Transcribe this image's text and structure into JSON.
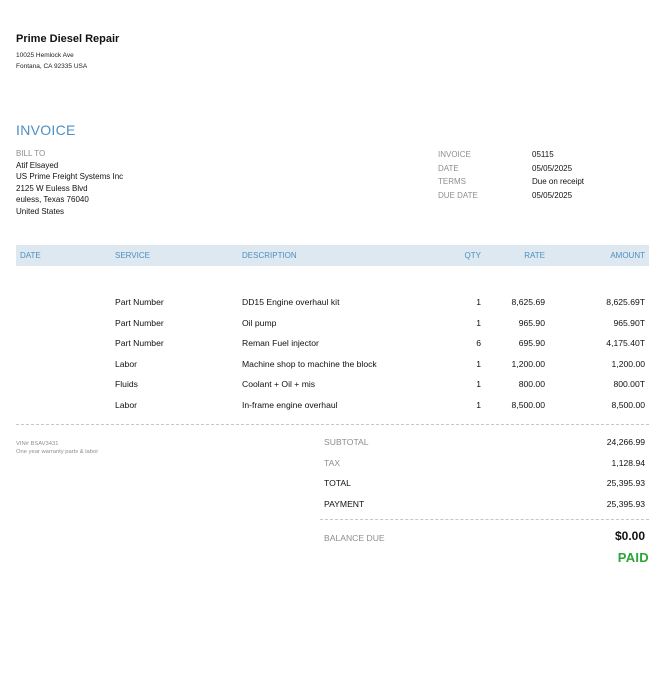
{
  "company": {
    "name": "Prime Diesel Repair",
    "address_line1": "10025 Hemlock Ave",
    "address_line2": "Fontana, CA  92335 USA"
  },
  "invoice_title": "INVOICE",
  "bill_to": {
    "label": "BILL TO",
    "lines": [
      "Atif Elsayed",
      "US Prime Freight Systems Inc",
      "2125 W Euless Blvd",
      "euless, Texas  76040",
      "United States"
    ]
  },
  "meta": [
    {
      "label": "INVOICE",
      "value": "05115"
    },
    {
      "label": "DATE",
      "value": "05/05/2025"
    },
    {
      "label": "TERMS",
      "value": "Due on receipt"
    },
    {
      "label": "DUE DATE",
      "value": "05/05/2025"
    }
  ],
  "table": {
    "headers": {
      "date": "DATE",
      "service": "SERVICE",
      "description": "DESCRIPTION",
      "qty": "QTY",
      "rate": "RATE",
      "amount": "AMOUNT"
    },
    "rows": [
      {
        "service": "Part Number",
        "description": "DD15 Engine overhaul kit",
        "qty": "1",
        "rate": "8,625.69",
        "amount": "8,625.69T"
      },
      {
        "service": "Part Number",
        "description": "Oil pump",
        "qty": "1",
        "rate": "965.90",
        "amount": "965.90T"
      },
      {
        "service": "Part Number",
        "description": "Reman Fuel injector",
        "qty": "6",
        "rate": "695.90",
        "amount": "4,175.40T"
      },
      {
        "service": "Labor",
        "description": "Machine shop to machine the block",
        "qty": "1",
        "rate": "1,200.00",
        "amount": "1,200.00"
      },
      {
        "service": "Fluids",
        "description": "Coolant + Oil + mis",
        "qty": "1",
        "rate": "800.00",
        "amount": "800.00T"
      },
      {
        "service": "Labor",
        "description": "In-frame engine overhaul",
        "qty": "1",
        "rate": "8,500.00",
        "amount": "8,500.00"
      }
    ]
  },
  "notes": {
    "vin": "VIN# BSAV3431",
    "warranty": "One year warranty parts & labor"
  },
  "totals": {
    "subtotal_label": "SUBTOTAL",
    "subtotal": "24,266.99",
    "tax_label": "TAX",
    "tax": "1,128.94",
    "total_label": "TOTAL",
    "total": "25,395.93",
    "payment_label": "PAYMENT",
    "payment": "25,395.93",
    "balance_label": "BALANCE DUE",
    "balance": "$0.00",
    "status": "PAID"
  },
  "colors": {
    "accent": "#4d8fc0",
    "header_bg": "#dde8f1",
    "paid": "#2aa63a",
    "muted": "#8a8f94"
  }
}
